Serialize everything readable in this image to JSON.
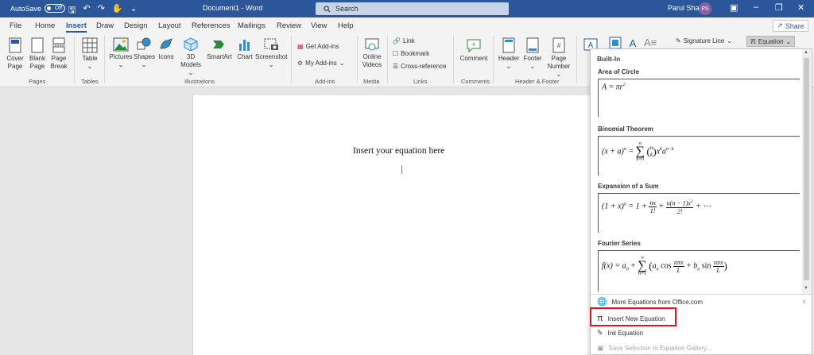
{
  "titlebar": {
    "autosave_label": "AutoSave",
    "autosave_state": "Off",
    "doc_title": "Document1 - Word",
    "search_placeholder": "Search",
    "user_name": "Parul Sharma",
    "user_initials": "PS"
  },
  "menu": {
    "tabs": [
      "File",
      "Home",
      "Insert",
      "Draw",
      "Design",
      "Layout",
      "References",
      "Mailings",
      "Review",
      "View",
      "Help"
    ],
    "active": "Insert",
    "share_label": "Share"
  },
  "ribbon": {
    "pages": {
      "cover_page": "Cover",
      "cover_page2": "Page",
      "blank_page": "Blank",
      "blank_page2": "Page",
      "page_break": "Page",
      "page_break2": "Break",
      "group": "Pages"
    },
    "tables": {
      "table": "Table",
      "group": "Tables"
    },
    "illustrations": {
      "pictures": "Pictures",
      "shapes": "Shapes",
      "icons": "Icons",
      "models": "3D",
      "models2": "Models",
      "smartart": "SmartArt",
      "chart": "Chart",
      "screenshot": "Screenshot",
      "group": "Illustrations"
    },
    "addins": {
      "get": "Get Add-ins",
      "my": "My Add-ins",
      "group": "Add-ins"
    },
    "media": {
      "online": "Online",
      "online2": "Videos",
      "group": "Media"
    },
    "links": {
      "link": "Link",
      "bookmark": "Bookmark",
      "crossref": "Cross-reference",
      "group": "Links"
    },
    "comments": {
      "comment": "Comment",
      "group": "Comments"
    },
    "header_footer": {
      "header": "Header",
      "footer": "Footer",
      "page_number": "Page",
      "page_number2": "Number",
      "group": "Header & Footer"
    },
    "text": {
      "signature_line": "Signature Line",
      "equation": "Equation"
    }
  },
  "document": {
    "body_text": "Insert your equation here"
  },
  "equation_menu": {
    "heading": "Built-In",
    "sections": [
      {
        "title": "Area of Circle"
      },
      {
        "title": "Binomial Theorem"
      },
      {
        "title": "Expansion of a Sum"
      },
      {
        "title": "Fourier Series"
      }
    ],
    "items": {
      "more": "More Equations from Office.com",
      "insert_new": "Insert New Equation",
      "ink": "Ink Equation",
      "save_selection": "Save Selection to Equation Gallery..."
    }
  },
  "colors": {
    "word_blue": "#2b579a",
    "highlight_red": "#e8141c"
  }
}
